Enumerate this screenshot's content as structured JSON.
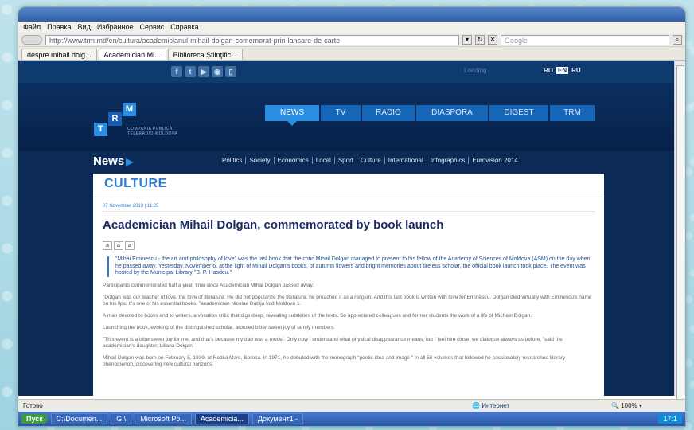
{
  "browser": {
    "menu": [
      "Файл",
      "Правка",
      "Вид",
      "Избранное",
      "Сервис",
      "Справка"
    ],
    "url": "http://www.trm.md/en/cultura/academicianul-mihail-dolgan-comemorat-prin-lansare-de-carte",
    "search_placeholder": "Google",
    "tabs": [
      "despre mihail dolg...",
      "Academician Mi...",
      "Biblioteca Ştiinţific..."
    ],
    "status_text": "Готово",
    "status_zone": "Интернет",
    "zoom": "100%"
  },
  "site": {
    "loading_text": "Loading",
    "languages": [
      "RO",
      "EN",
      "RU"
    ],
    "active_language": "EN",
    "logo_letters": [
      "T",
      "R",
      "M"
    ],
    "logo_text_1": "COMPANIA PUBLICĂ",
    "logo_text_2": "TELERADIO-MOLDOVA",
    "main_nav": [
      "NEWS",
      "TV",
      "RADIO",
      "DIASPORA",
      "DIGEST",
      "TRM"
    ],
    "news_label": "News",
    "sub_nav": [
      "Politics",
      "Society",
      "Economics",
      "Local",
      "Sport",
      "Culture",
      "International",
      "Infographics",
      "Eurovision 2014"
    ],
    "section": "CULTURE",
    "article": {
      "date": "07 November 2013 | 11:25",
      "headline": "Academician Mihail Dolgan, commemorated by book launch",
      "size_buttons": [
        "a",
        "a",
        "a"
      ],
      "lead": "\"Mihai Eminescu - the art and philosophy of love\" was the last book that the critic Mihail Dolgan managed to present to his fellow of the Academy of Sciences of Moldova (ASM) on the day when he passed away. Yesterday, November 6, at the light of Mihail Dolgan's books, of autumn flowers and bright memories about tireless scholar, the official book launch took place. The event was hosted by the Municipal Library \"B. P. Hasdeu.\"",
      "paragraphs": [
        "Participants commemorated half a year, time since Academician Mihai Dolgan passed away.",
        "\"Dolgan was our teacher of love, the love of literature. He did not popularize the literature, he preached it as a religion. And this last book is written with love for Eminescu. Dolgan died virtually with Eminescu's name on his lips. It's one of his essential books, \"academician Nicolae Dabija told Moldova 1.",
        "A man devoted to books and to writers, a vocation critic that digs deep, revealing subtleties of the texts. So appreciated colleagues and former students the work of a life of Michael Dolgan.",
        "Launching the book, evoking of the distinguished scholar, aroused bitter sweet joy of family members.",
        "\"This event is a bittersweet joy for me, and that's because my dad was a model. Only now I understand what physical disappearance means, but I feel him close, we dialogue always as before, \"said the academician's daughter, Liliana Dolgan.",
        "Mihail Dolgan was born on February 5, 1939, at Rediul Mare, Soroca. In 1971, he debuted with the monograph \"poetic idea and image \" in all 50 volumes that followed he passionately researched literary phenomenon, discovering new cultural horizons."
      ]
    }
  },
  "taskbar": {
    "start": "Пуск",
    "items": [
      "C:\\Documen...",
      "G:\\",
      "Microsoft Po...",
      "Academicia...",
      "Документ1 -"
    ],
    "clock": "17:1"
  }
}
